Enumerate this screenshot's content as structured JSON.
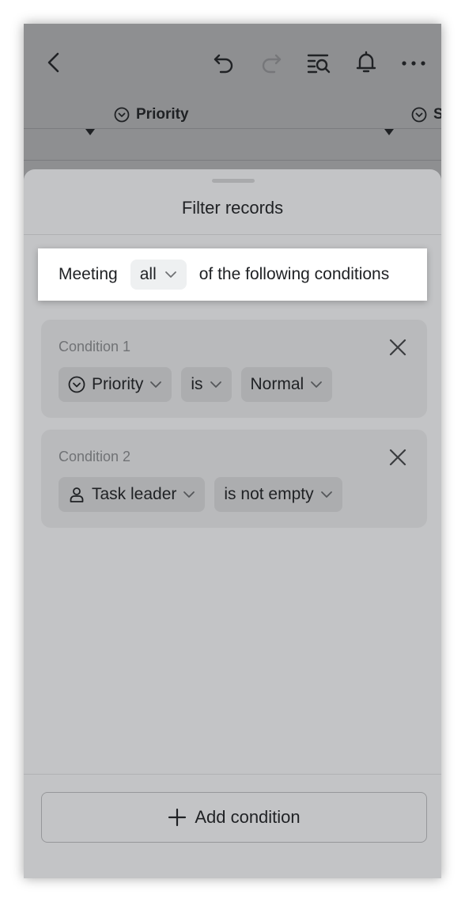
{
  "toolbar": {
    "back_icon": "chevron-left-icon",
    "undo_icon": "undo-icon",
    "redo_icon": "redo-icon",
    "search_icon": "list-search-icon",
    "bell_icon": "bell-icon",
    "more_icon": "more-icon"
  },
  "columns": {
    "priority_label": "Priority",
    "next_label": "S"
  },
  "sheet": {
    "title": "Filter records",
    "meeting_prefix": "Meeting",
    "match_mode": "all",
    "meeting_suffix": "of the following conditions"
  },
  "conditions": [
    {
      "title": "Condition 1",
      "field": "Priority",
      "field_icon": "circle-chevron-down-icon",
      "operator": "is",
      "value": "Normal"
    },
    {
      "title": "Condition 2",
      "field": "Task leader",
      "field_icon": "person-icon",
      "operator": "is not empty"
    }
  ],
  "footer": {
    "add_label": "Add condition"
  }
}
